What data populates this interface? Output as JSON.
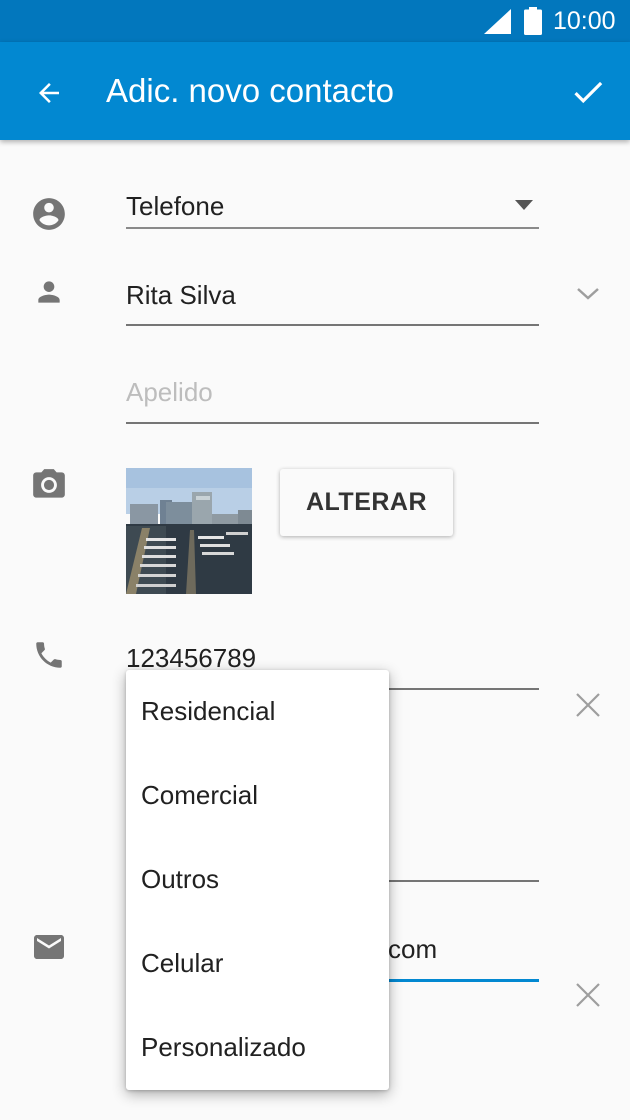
{
  "status_bar": {
    "time": "10:00"
  },
  "toolbar": {
    "title": "Adic. novo contacto"
  },
  "account": {
    "value": "Telefone"
  },
  "name": {
    "value": "Rita Silva"
  },
  "surname": {
    "placeholder": "Apelido"
  },
  "photo": {
    "change_label": "ALTERAR"
  },
  "phone": {
    "value": "123456789"
  },
  "email": {
    "value_suffix": "com"
  },
  "phone_type_menu": {
    "items": [
      {
        "label": "Residencial"
      },
      {
        "label": "Comercial"
      },
      {
        "label": "Outros"
      },
      {
        "label": "Celular"
      },
      {
        "label": "Personalizado"
      }
    ]
  },
  "colors": {
    "status_bar": "#0277bd",
    "app_bar": "#0288d1",
    "background": "#fafafa"
  }
}
